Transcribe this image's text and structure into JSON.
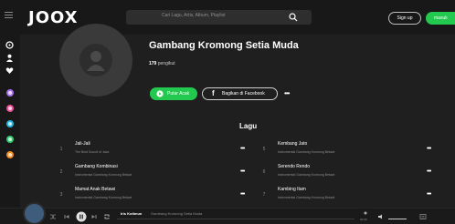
{
  "header": {
    "logo": "JOOX",
    "search_placeholder": "Cari Lagu, Artis, Album, Playlist",
    "signup_label": "Sign up",
    "login_label": "masuk"
  },
  "sidebar": {
    "icons": [
      "music-icon",
      "person-icon",
      "heart-icon"
    ],
    "dot_colors": [
      "#a86ff0",
      "#ef4f9a",
      "#22b5dc",
      "#2ecc71",
      "#f58a1f"
    ]
  },
  "playlist": {
    "title": "Gambang Kromong Setia Muda",
    "followers_count": "179",
    "followers_label": "pengikut",
    "play_label": "Putar Acak",
    "share_label": "Bagikan di Facebook",
    "more_label": "•••"
  },
  "songs_section": {
    "title": "Lagu",
    "rows": [
      {
        "num": "1",
        "name": "Jali-Jali",
        "sub": "The Best Sound of Java"
      },
      {
        "num": "2",
        "name": "Gambang Kombinasi",
        "sub": "Instrumental Gambang Kromong Betawi"
      },
      {
        "num": "3",
        "name": "Mamat Anak Betawi",
        "sub": "Instrumental Gambang Kromong Betawi"
      },
      {
        "num": "5",
        "name": "Kembang Jato",
        "sub": "Instrumental Gambang Kromong Betawi"
      },
      {
        "num": "6",
        "name": "Serendo Rendo",
        "sub": "Instrumental Gambang Kromong Betawi"
      },
      {
        "num": "7",
        "name": "Kambing Itam",
        "sub": "Instrumental Gambang Kromong Betawi"
      }
    ],
    "more_label": "•••"
  },
  "player": {
    "now_title": "Iris Kotimun",
    "now_sub": "Gambang Kromong Setia Muda",
    "time": "00:00"
  },
  "colors": {
    "accent": "#23c94e",
    "background": "#1f1f1f",
    "bar": "#181818"
  }
}
